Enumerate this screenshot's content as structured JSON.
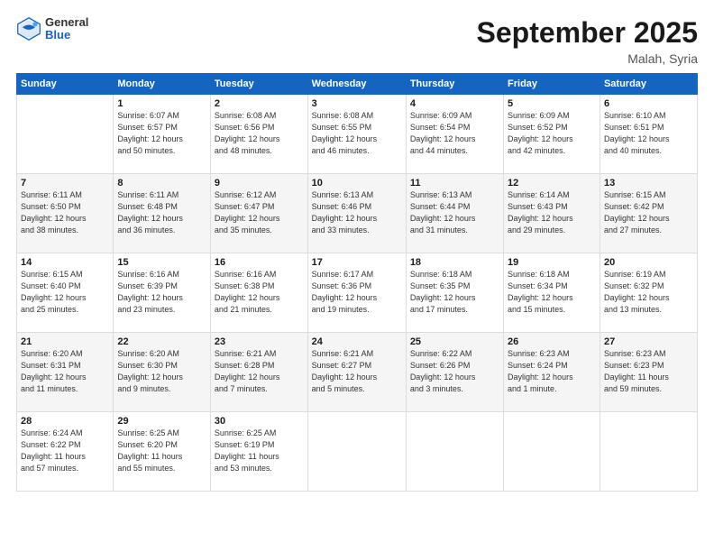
{
  "header": {
    "logo": {
      "general": "General",
      "blue": "Blue"
    },
    "title": "September 2025",
    "location": "Malah, Syria"
  },
  "calendar": {
    "days_of_week": [
      "Sunday",
      "Monday",
      "Tuesday",
      "Wednesday",
      "Thursday",
      "Friday",
      "Saturday"
    ],
    "weeks": [
      [
        {
          "day": "",
          "info": ""
        },
        {
          "day": "1",
          "info": "Sunrise: 6:07 AM\nSunset: 6:57 PM\nDaylight: 12 hours\nand 50 minutes."
        },
        {
          "day": "2",
          "info": "Sunrise: 6:08 AM\nSunset: 6:56 PM\nDaylight: 12 hours\nand 48 minutes."
        },
        {
          "day": "3",
          "info": "Sunrise: 6:08 AM\nSunset: 6:55 PM\nDaylight: 12 hours\nand 46 minutes."
        },
        {
          "day": "4",
          "info": "Sunrise: 6:09 AM\nSunset: 6:54 PM\nDaylight: 12 hours\nand 44 minutes."
        },
        {
          "day": "5",
          "info": "Sunrise: 6:09 AM\nSunset: 6:52 PM\nDaylight: 12 hours\nand 42 minutes."
        },
        {
          "day": "6",
          "info": "Sunrise: 6:10 AM\nSunset: 6:51 PM\nDaylight: 12 hours\nand 40 minutes."
        }
      ],
      [
        {
          "day": "7",
          "info": "Sunrise: 6:11 AM\nSunset: 6:50 PM\nDaylight: 12 hours\nand 38 minutes."
        },
        {
          "day": "8",
          "info": "Sunrise: 6:11 AM\nSunset: 6:48 PM\nDaylight: 12 hours\nand 36 minutes."
        },
        {
          "day": "9",
          "info": "Sunrise: 6:12 AM\nSunset: 6:47 PM\nDaylight: 12 hours\nand 35 minutes."
        },
        {
          "day": "10",
          "info": "Sunrise: 6:13 AM\nSunset: 6:46 PM\nDaylight: 12 hours\nand 33 minutes."
        },
        {
          "day": "11",
          "info": "Sunrise: 6:13 AM\nSunset: 6:44 PM\nDaylight: 12 hours\nand 31 minutes."
        },
        {
          "day": "12",
          "info": "Sunrise: 6:14 AM\nSunset: 6:43 PM\nDaylight: 12 hours\nand 29 minutes."
        },
        {
          "day": "13",
          "info": "Sunrise: 6:15 AM\nSunset: 6:42 PM\nDaylight: 12 hours\nand 27 minutes."
        }
      ],
      [
        {
          "day": "14",
          "info": "Sunrise: 6:15 AM\nSunset: 6:40 PM\nDaylight: 12 hours\nand 25 minutes."
        },
        {
          "day": "15",
          "info": "Sunrise: 6:16 AM\nSunset: 6:39 PM\nDaylight: 12 hours\nand 23 minutes."
        },
        {
          "day": "16",
          "info": "Sunrise: 6:16 AM\nSunset: 6:38 PM\nDaylight: 12 hours\nand 21 minutes."
        },
        {
          "day": "17",
          "info": "Sunrise: 6:17 AM\nSunset: 6:36 PM\nDaylight: 12 hours\nand 19 minutes."
        },
        {
          "day": "18",
          "info": "Sunrise: 6:18 AM\nSunset: 6:35 PM\nDaylight: 12 hours\nand 17 minutes."
        },
        {
          "day": "19",
          "info": "Sunrise: 6:18 AM\nSunset: 6:34 PM\nDaylight: 12 hours\nand 15 minutes."
        },
        {
          "day": "20",
          "info": "Sunrise: 6:19 AM\nSunset: 6:32 PM\nDaylight: 12 hours\nand 13 minutes."
        }
      ],
      [
        {
          "day": "21",
          "info": "Sunrise: 6:20 AM\nSunset: 6:31 PM\nDaylight: 12 hours\nand 11 minutes."
        },
        {
          "day": "22",
          "info": "Sunrise: 6:20 AM\nSunset: 6:30 PM\nDaylight: 12 hours\nand 9 minutes."
        },
        {
          "day": "23",
          "info": "Sunrise: 6:21 AM\nSunset: 6:28 PM\nDaylight: 12 hours\nand 7 minutes."
        },
        {
          "day": "24",
          "info": "Sunrise: 6:21 AM\nSunset: 6:27 PM\nDaylight: 12 hours\nand 5 minutes."
        },
        {
          "day": "25",
          "info": "Sunrise: 6:22 AM\nSunset: 6:26 PM\nDaylight: 12 hours\nand 3 minutes."
        },
        {
          "day": "26",
          "info": "Sunrise: 6:23 AM\nSunset: 6:24 PM\nDaylight: 12 hours\nand 1 minute."
        },
        {
          "day": "27",
          "info": "Sunrise: 6:23 AM\nSunset: 6:23 PM\nDaylight: 11 hours\nand 59 minutes."
        }
      ],
      [
        {
          "day": "28",
          "info": "Sunrise: 6:24 AM\nSunset: 6:22 PM\nDaylight: 11 hours\nand 57 minutes."
        },
        {
          "day": "29",
          "info": "Sunrise: 6:25 AM\nSunset: 6:20 PM\nDaylight: 11 hours\nand 55 minutes."
        },
        {
          "day": "30",
          "info": "Sunrise: 6:25 AM\nSunset: 6:19 PM\nDaylight: 11 hours\nand 53 minutes."
        },
        {
          "day": "",
          "info": ""
        },
        {
          "day": "",
          "info": ""
        },
        {
          "day": "",
          "info": ""
        },
        {
          "day": "",
          "info": ""
        }
      ]
    ]
  }
}
